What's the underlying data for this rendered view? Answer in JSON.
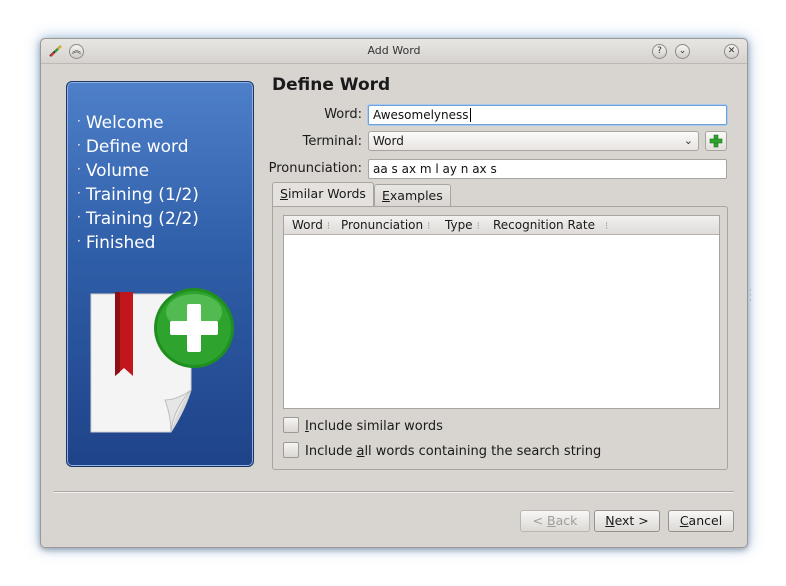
{
  "window": {
    "title": "Add Word"
  },
  "wizard": {
    "steps": [
      "Welcome",
      "Define word",
      "Volume",
      "Training (1/2)",
      "Training (2/2)",
      "Finished"
    ]
  },
  "page": {
    "heading": "Define Word",
    "word_label": "Word:",
    "word_value": "Awesomelyness",
    "terminal_label": "Terminal:",
    "terminal_value": "Word",
    "pronunciation_label": "Pronunciation:",
    "pronunciation_value": "aa s ax m l ay n ax s"
  },
  "tabs": {
    "similar_words_accel": "S",
    "similar_words_rest": "imilar Words",
    "examples_accel": "E",
    "examples_rest": "xamples"
  },
  "table": {
    "columns": [
      "Word",
      "Pronunciation",
      "Type",
      "Recognition Rate"
    ],
    "rows": []
  },
  "options": {
    "include_similar_pre": "",
    "include_similar_accel": "I",
    "include_similar_rest": "nclude similar words",
    "include_all_pre": "Include ",
    "include_all_accel": "a",
    "include_all_rest": "ll words containing the search string"
  },
  "buttons": {
    "back_pre": "< ",
    "back_accel": "B",
    "back_rest": "ack",
    "next_accel": "N",
    "next_rest": "ext >",
    "cancel_accel": "C",
    "cancel_rest": "ancel"
  },
  "colors": {
    "side_panel_top": "#4e7fc9",
    "side_panel_bottom": "#1f4389",
    "dialog_bg": "#d8d4d0",
    "accent_green": "#2ea32e",
    "bookmark_red": "#c0161c"
  },
  "icons": [
    "app-icon",
    "keep-above-icon",
    "help-icon",
    "minimize-icon",
    "close-icon",
    "add-icon",
    "chevron-down-icon",
    "add-word-artwork"
  ]
}
